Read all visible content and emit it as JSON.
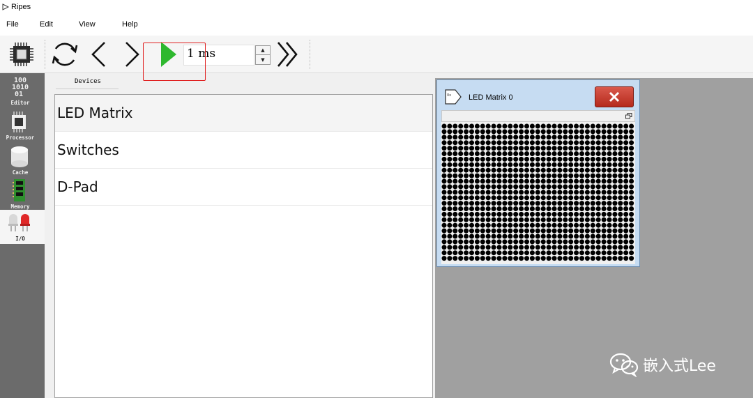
{
  "window": {
    "title": "Ripes"
  },
  "menu": {
    "items": [
      "File",
      "Edit",
      "View",
      "Help"
    ]
  },
  "toolbar": {
    "interval_value": "1 ms",
    "icons": [
      "processor-select-icon",
      "reset-icon",
      "reverse-icon",
      "step-icon",
      "run-icon",
      "fast-execution-icon"
    ]
  },
  "sidebar": {
    "items": [
      {
        "label": "Editor",
        "icon": "editor-icon",
        "active": false
      },
      {
        "label": "Processor",
        "icon": "processor-icon",
        "active": false
      },
      {
        "label": "Cache",
        "icon": "cache-icon",
        "active": false
      },
      {
        "label": "Memory",
        "icon": "memory-icon",
        "active": false
      },
      {
        "label": "I/O",
        "icon": "io-icon",
        "active": true
      }
    ],
    "editor_icon_text": [
      "100",
      "1010",
      "01"
    ]
  },
  "devices": {
    "tab_label": "Devices",
    "items": [
      "LED Matrix",
      "Switches",
      "D-Pad"
    ],
    "selected": "LED Matrix"
  },
  "led_window": {
    "title": "LED Matrix 0",
    "icon_text": "0x",
    "close_symbol": "✕",
    "grid": {
      "rows": 25,
      "cols": 35,
      "led_color": "#000000"
    }
  },
  "watermark": {
    "text": "嵌入式Lee"
  },
  "colors": {
    "highlight": "#e02020",
    "run_green": "#2eb82e",
    "sidebar_bg": "#6b6b6b",
    "mdi_bg": "#a0a0a0",
    "close_red": "#c8402f"
  }
}
